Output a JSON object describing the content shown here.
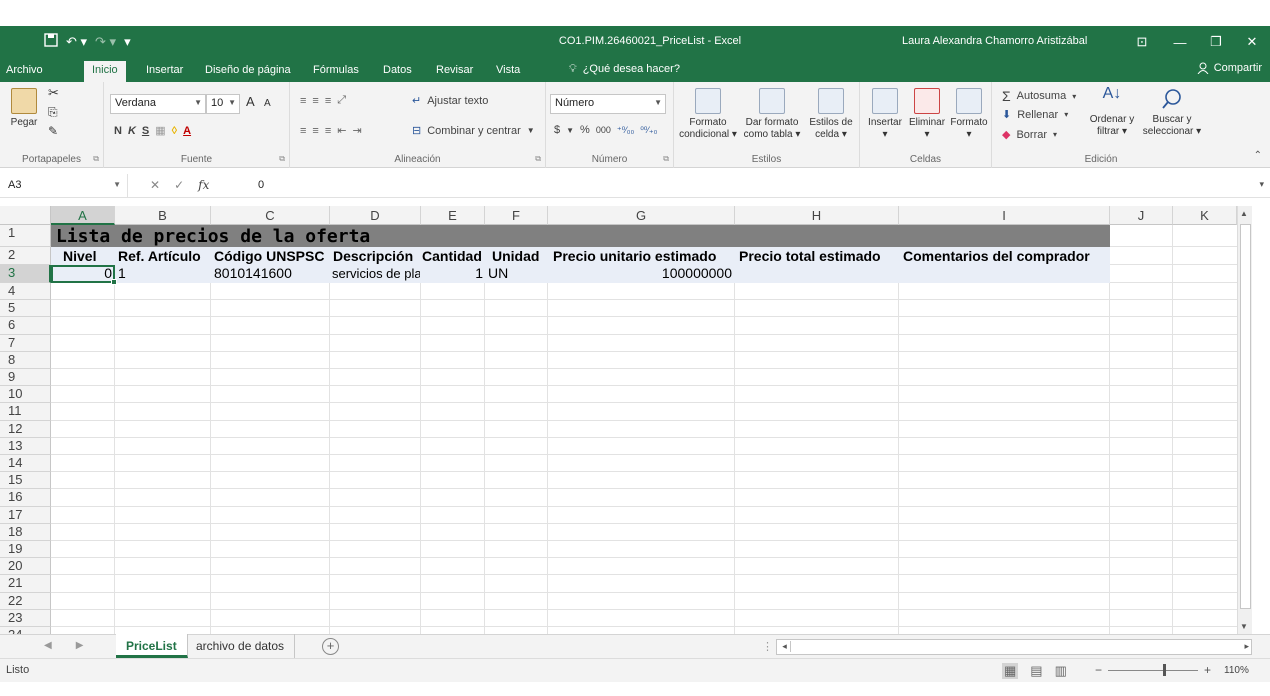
{
  "window": {
    "doc_title": "CO1.PIM.26460021_PriceList - Excel",
    "user": "Laura Alexandra Chamorro Aristizábal",
    "qat_save_icon": "save-icon",
    "qat_undo": "↶ ▾",
    "qat_redo": "↷ ▾",
    "qat_more": "▾",
    "ribbon_options": "⊡",
    "minimize": "—",
    "restore": "❐",
    "close": "✕"
  },
  "tabs": [
    "Archivo",
    "Inicio",
    "Insertar",
    "Diseño de página",
    "Fórmulas",
    "Datos",
    "Revisar",
    "Vista"
  ],
  "tell_me": "¿Qué desea hacer?",
  "share": "Compartir",
  "ribbon": {
    "clipboard": {
      "label": "Portapapeles",
      "paste": "Pegar"
    },
    "font": {
      "label": "Fuente",
      "name": "Verdana",
      "size": "10",
      "grow": "A",
      "shrink": "A",
      "bold": "N",
      "italic": "K",
      "underline": "S",
      "borders": "▦",
      "fill": "◊",
      "fontcolor": "A"
    },
    "alignment": {
      "label": "Alineación",
      "wrap": "Ajustar texto",
      "merge": "Combinar y centrar"
    },
    "number": {
      "label": "Número",
      "format": "Número",
      "currency": "$",
      "percent": "%",
      "thousands": "000",
      "inc_dec": "⁺⁰⁄₀₀",
      "dec_dec": "⁰⁰⁄₊₀"
    },
    "styles": {
      "label": "Estilos",
      "cond1": "Formato",
      "cond2": "condicional ▾",
      "table1": "Dar formato",
      "table2": "como tabla ▾",
      "cell1": "Estilos de",
      "cell2": "celda ▾"
    },
    "cells": {
      "label": "Celdas",
      "insert": "Insertar",
      "delete": "Eliminar",
      "format": "Formato"
    },
    "editing": {
      "label": "Edición",
      "autosum": "Autosuma",
      "fill": "Rellenar",
      "clear": "Borrar",
      "sort1": "Ordenar y",
      "sort2": "filtrar ▾",
      "find1": "Buscar y",
      "find2": "seleccionar ▾"
    }
  },
  "formula_bar": {
    "name_box": "A3",
    "value": "0",
    "cancel": "✕",
    "enter": "✓",
    "fx": "fx"
  },
  "columns": [
    "A",
    "B",
    "C",
    "D",
    "E",
    "F",
    "G",
    "H",
    "I",
    "J",
    "K"
  ],
  "rows": [
    "1",
    "2",
    "3",
    "4",
    "5",
    "6",
    "7",
    "8",
    "9",
    "10",
    "11",
    "12",
    "13",
    "14",
    "15",
    "16",
    "17",
    "18",
    "19",
    "20",
    "21",
    "22",
    "23",
    "24"
  ],
  "sheet": {
    "title": "Lista de precios de la oferta",
    "headers": [
      "Nivel",
      "Ref. Artículo",
      "Código UNSPSC",
      "Descripción",
      "Cantidad",
      "Unidad",
      "Precio unitario estimado",
      "Precio total estimado",
      "Comentarios del comprador"
    ],
    "row3": [
      "0",
      "1",
      "8010141600",
      "servicios de pla",
      "1",
      "UN",
      "100000000",
      "",
      ""
    ]
  },
  "sheet_tabs": [
    "PriceList",
    "archivo de datos"
  ],
  "sheet_nav_prev": "◀",
  "sheet_nav_next": "▶",
  "add_sheet": "+",
  "status": "Listo",
  "zoom": "110%",
  "colors": {
    "accent": "#217346",
    "title_fill": "#808080",
    "band": "#e9eef7"
  }
}
